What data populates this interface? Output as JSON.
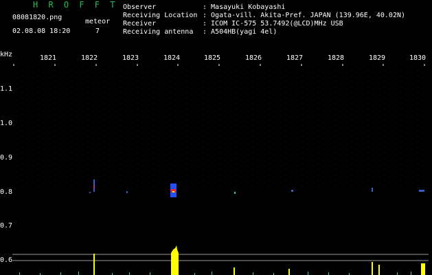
{
  "header": {
    "title": "H R O F F T",
    "filename": "08081820.png",
    "datetime": "02.08.08 18:20",
    "meteor_label": "meteor",
    "meteor_count": "7"
  },
  "info": [
    {
      "key": "Observer",
      "value": ": Masayuki Kobayashi"
    },
    {
      "key": "Receiving Location",
      "value": ": Ogata-vill. Akita-Pref. JAPAN (139.96E, 40.02N)"
    },
    {
      "key": "Receiver",
      "value": ": ICOM IC-575 53.7492(@LCD)MHz USB"
    },
    {
      "key": "Receiving antenna",
      "value": ": A504HB(yagi 4el)"
    }
  ],
  "axis": {
    "y_unit": "kHz",
    "x_ticks": [
      "1821",
      "1822",
      "1823",
      "1824",
      "1825",
      "1826",
      "1827",
      "1828",
      "1829",
      "1830"
    ],
    "y_ticks": [
      "1.1",
      "1.0",
      "0.9",
      "0.8",
      "0.7",
      "0.6"
    ]
  },
  "colors": {
    "title": "#20c050",
    "echo_red": "#ff2020",
    "echo_blue": "#2050ff",
    "bar_yellow": "#ffff00",
    "bar_cyan": "#40c0c0",
    "threshold_line": "#a0a0a0"
  }
}
